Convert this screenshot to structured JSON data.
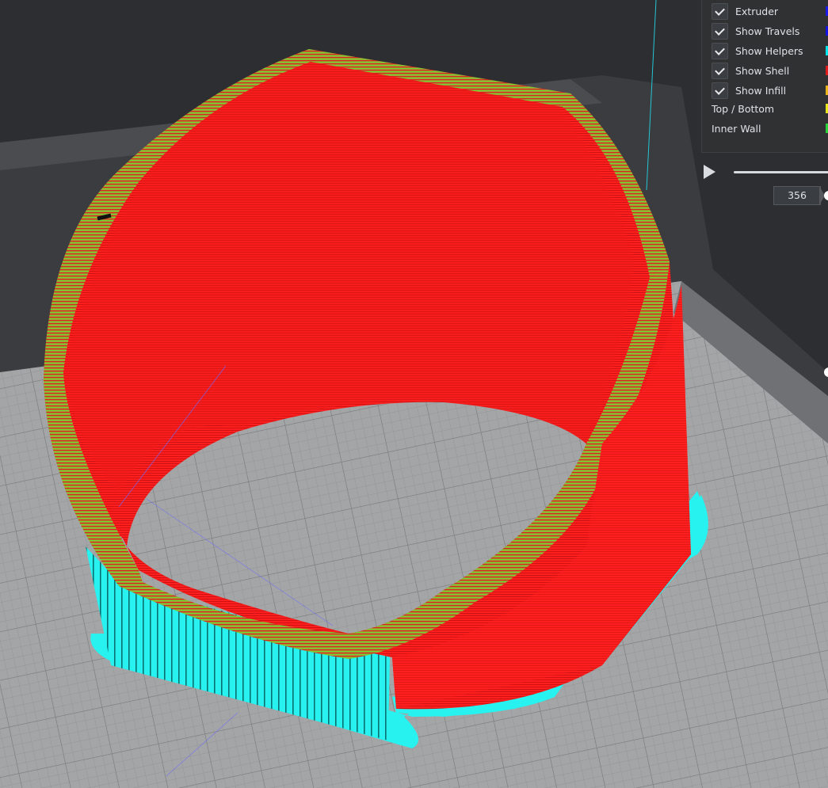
{
  "legend": {
    "rows": [
      {
        "label": "Extruder",
        "checked": true,
        "swatch": "#1a1ae6",
        "swatch_icon": "extruder-color"
      },
      {
        "label": "Show Travels",
        "checked": true,
        "swatch": "#1414e0"
      },
      {
        "label": "Show Helpers",
        "checked": true,
        "swatch": "#00e5ee"
      },
      {
        "label": "Show Shell",
        "checked": true,
        "swatch": "#e01c1c"
      },
      {
        "label": "Show Infill",
        "checked": true,
        "swatch": "#e8b51c"
      }
    ],
    "line_types": [
      {
        "label": "Top / Bottom",
        "swatch": "#e8e61c"
      },
      {
        "label": "Inner Wall",
        "swatch": "#28d43a"
      }
    ]
  },
  "layer_slider": {
    "current_layer": "356"
  },
  "colors": {
    "shell": "#ff1f1f",
    "helpers": "#26f0ee",
    "inner_wall": "#7fcc2e",
    "build_plate": "#a4a5a6",
    "background": "#2b2d30"
  }
}
